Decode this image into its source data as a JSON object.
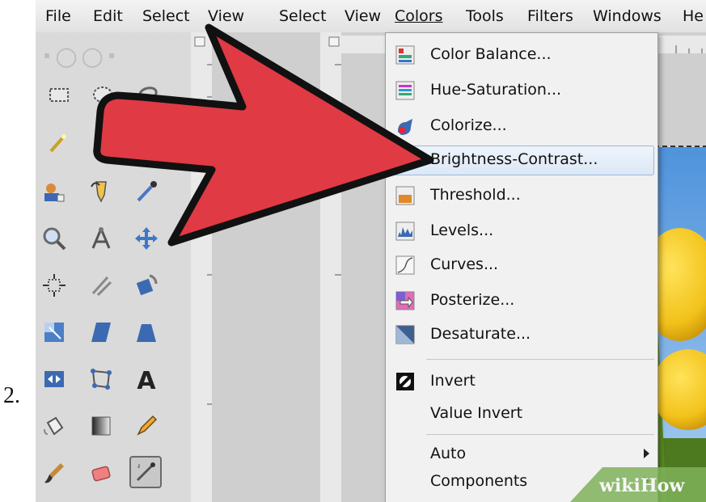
{
  "step_label": "2.",
  "menubar": {
    "items": [
      "File",
      "Edit",
      "Select",
      "View",
      "Select",
      "View",
      "Colors",
      "Tools",
      "Filters",
      "Windows",
      "He"
    ],
    "active": "Colors"
  },
  "colors_menu": {
    "items": [
      {
        "label": "Color Balance...",
        "icon": "color-balance-icon"
      },
      {
        "label": "Hue-Saturation...",
        "icon": "hue-saturation-icon"
      },
      {
        "label": "Colorize...",
        "icon": "colorize-icon"
      },
      {
        "label": "Brightness-Contrast...",
        "icon": "brightness-contrast-icon",
        "highlighted": true
      },
      {
        "label": "Threshold...",
        "icon": "threshold-icon"
      },
      {
        "label": "Levels...",
        "icon": "levels-icon"
      },
      {
        "label": "Curves...",
        "icon": "curves-icon"
      },
      {
        "label": "Posterize...",
        "icon": "posterize-icon"
      },
      {
        "label": "Desaturate...",
        "icon": "desaturate-icon"
      },
      {
        "label": "Invert",
        "icon": "invert-icon"
      },
      {
        "label": "Value Invert",
        "icon": ""
      },
      {
        "label": "Auto",
        "icon": "",
        "submenu": true
      },
      {
        "label": "Components",
        "icon": "",
        "submenu": true
      }
    ]
  },
  "watermark": {
    "part1": "wiki",
    "part2": "How"
  },
  "colors": {
    "menu_highlight": "#dce8f6",
    "arrow_red": "#e03a44",
    "sky_blue": "#5fa3e0",
    "tulip_yellow": "#f2c21a"
  }
}
